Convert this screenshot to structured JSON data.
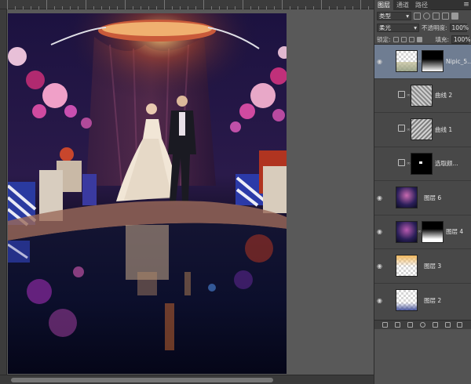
{
  "panel": {
    "tabs": [
      "图层",
      "通道",
      "路径"
    ],
    "filter": {
      "label": "类型",
      "icons": [
        "pixel-filter-icon",
        "adjustment-filter-icon",
        "type-filter-icon",
        "shape-filter-icon",
        "smart-object-filter-icon"
      ]
    },
    "blend": {
      "mode": "柔光",
      "opacity_label": "不透明度:",
      "opacity_value": "100%"
    },
    "lock": {
      "label": "锁定:",
      "fill_label": "填充:",
      "fill_value": "100%"
    },
    "layers": [
      {
        "name": "Nipic_5...",
        "type": "image-with-mask",
        "selected": true
      },
      {
        "name": "曲线 2",
        "type": "adjustment-curves",
        "selected": false
      },
      {
        "name": "曲线 1",
        "type": "adjustment-curves",
        "selected": false
      },
      {
        "name": "选取颜...",
        "type": "adjustment-selective-color",
        "selected": false
      },
      {
        "name": "图层 6",
        "type": "image",
        "selected": false
      },
      {
        "name": "图层 4",
        "type": "image-with-mask",
        "selected": false
      },
      {
        "name": "图层 3",
        "type": "gradient-orange",
        "selected": false
      },
      {
        "name": "图层 2",
        "type": "gradient-blue",
        "selected": false
      }
    ],
    "footer_icons": [
      "link-layers-icon",
      "fx-icon",
      "add-mask-icon",
      "new-adjustment-icon",
      "new-group-icon",
      "new-layer-icon",
      "delete-layer-icon"
    ]
  },
  "colors": {
    "selected_layer": "#6f7d92",
    "panel_bg": "#484848",
    "workspace": "#595959"
  }
}
